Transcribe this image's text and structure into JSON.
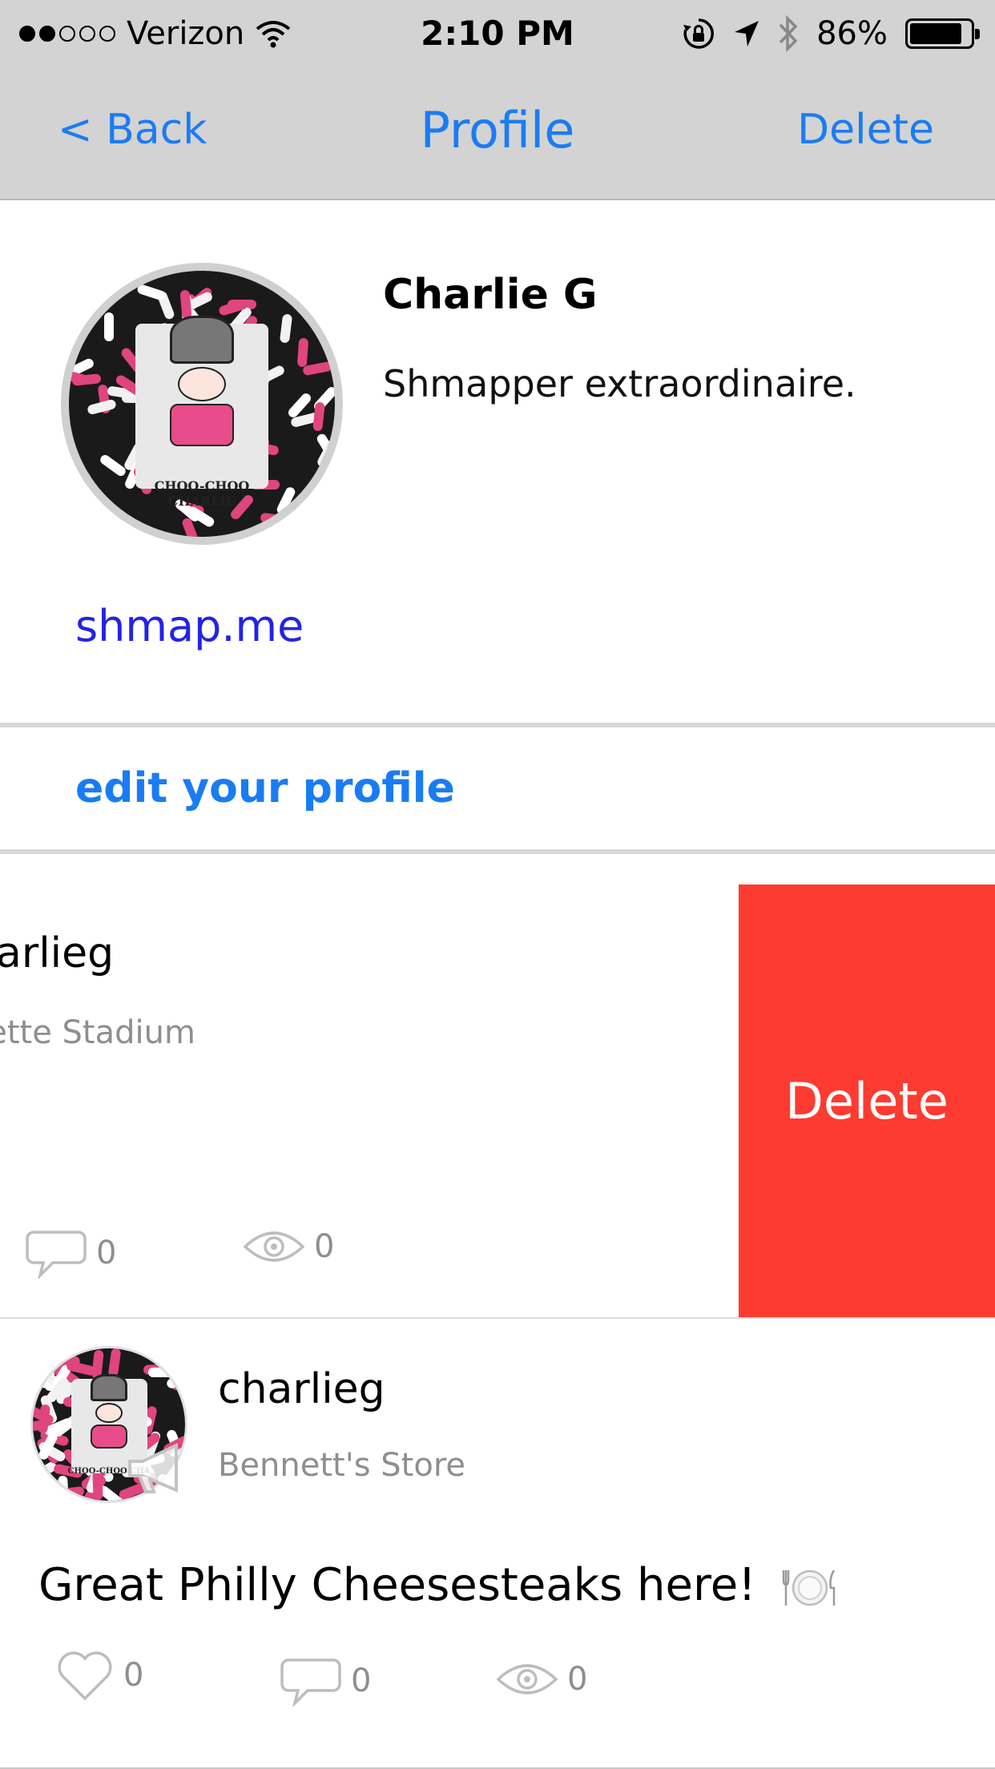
{
  "status_bar": {
    "carrier": "Verizon",
    "time": "2:10 PM",
    "battery_pct_label": "86%",
    "battery_level": 0.86,
    "signal_bars_filled": 2,
    "signal_bars_total": 5
  },
  "nav": {
    "back_label": "< Back",
    "title": "Profile",
    "delete_label": "Delete"
  },
  "profile": {
    "name": "Charlie G",
    "bio": "Shmapper extraordinaire.",
    "link": "shmap.me",
    "avatar_caption": "CHOO-CHOO CHARLIE"
  },
  "edit_profile_label": "edit your profile",
  "posts": [
    {
      "username": "harlieg",
      "location": "llette Stadium",
      "comments": "0",
      "views": "0",
      "swipe_action_label": "Delete"
    },
    {
      "username": "charlieg",
      "location": "Bennett's Store",
      "text": "Great Philly Cheesesteaks here!",
      "likes": "0",
      "comments": "0",
      "views": "0",
      "avatar_caption": "CHOO-CHOO CHA"
    }
  ],
  "colors": {
    "ios_blue": "#1a7cf3",
    "link_blue": "#2323e6",
    "delete_red": "#fe3b30",
    "bar_gray": "#d3d3d3",
    "muted_text": "#8e8e8e"
  },
  "icons": {
    "wifi": "wifi-icon",
    "rotation_lock": "rotation-lock-icon",
    "location": "location-arrow-icon",
    "bluetooth": "bluetooth-icon",
    "comment": "comment-bubble-icon",
    "view": "eye-icon",
    "like": "heart-icon",
    "announce": "megaphone-icon",
    "food": "plate-cutlery-icon"
  }
}
